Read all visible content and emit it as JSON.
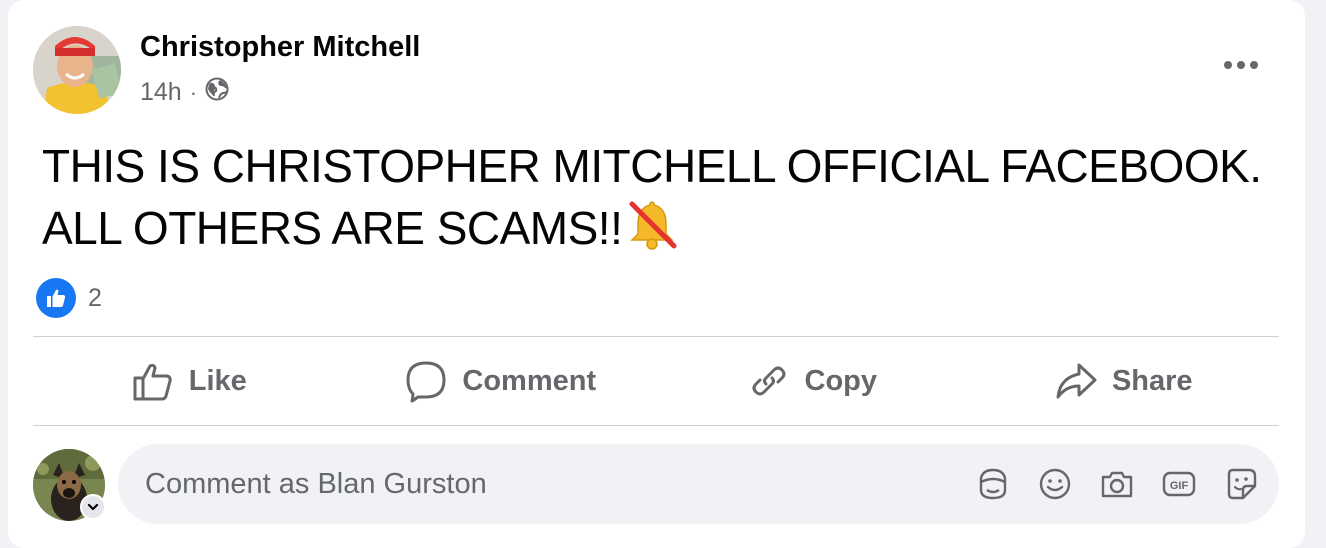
{
  "post": {
    "author": "Christopher Mitchell",
    "timestamp": "14h",
    "separator": "·",
    "audience_icon": "globe-icon",
    "more_icon": "more-options-icon",
    "text": "THIS IS CHRISTOPHER MITCHELL OFFICIAL FACEBOOK. ALL OTHERS ARE SCAMS!!",
    "emoji": "no-bell-emoji"
  },
  "reactions": {
    "icon": "like-reaction-icon",
    "count": "2"
  },
  "actions": [
    {
      "label": "Like",
      "icon": "thumbs-up-icon"
    },
    {
      "label": "Comment",
      "icon": "comment-bubble-icon"
    },
    {
      "label": "Copy",
      "icon": "link-icon"
    },
    {
      "label": "Share",
      "icon": "share-arrow-icon"
    }
  ],
  "comment": {
    "placeholder": "Comment as Blan Gurston",
    "tools": [
      "avatar-sticker-icon",
      "emoji-icon",
      "camera-icon",
      "gif-icon",
      "sticker-icon"
    ]
  },
  "colors": {
    "brand_blue": "#1877f2",
    "secondary_text": "#65676b",
    "primary_text": "#050505",
    "input_bg": "#f0f2f5",
    "divider": "#ced0d4"
  }
}
